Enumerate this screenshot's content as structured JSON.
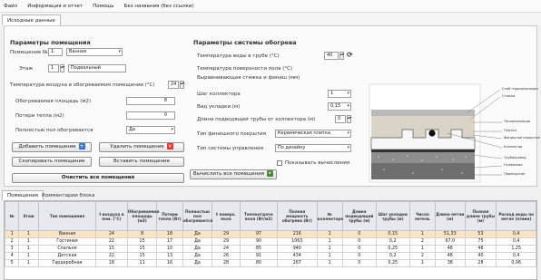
{
  "menu": [
    "Файл",
    "Информация и отчет",
    "Помощь",
    "Без названия (без ссылки)"
  ],
  "tabs": {
    "main": "Исходные данные"
  },
  "room_params": {
    "header": "Параметры помещения",
    "room_number_label": "Помещение №1",
    "room_number_value": "1",
    "room_name_value": "Ванная",
    "floor_label": "Этаж",
    "floor_value": "1",
    "floor_name_value": "Подвальный",
    "air_temp_label": "Температура воздуха в обогреваемом помещении (°C)",
    "air_temp_value": "24",
    "heated_area_label": "Обогреваемая площадь (м2)",
    "heated_area_value": "8",
    "heat_losses_label": "Потери тепла (м2)",
    "heat_losses_value": "0",
    "full_floor_label": "Полностью пол обогревается",
    "full_floor_value": "Да",
    "add_room_label": "Добавить помещение",
    "delete_room_label": "Удалить помещение",
    "copy_room_label": "Скопировать помещение",
    "paste_room_label": "Вставить помещение",
    "clear_rooms_label": "Очистить все помещения"
  },
  "heating_params": {
    "header": "Параметры системы обогрева",
    "water_temp_label": "Температура воды в трубе (°C)",
    "water_temp_value": "40",
    "return_temp_label": "Температура поверхности пола (°C)",
    "return_temp_value": "",
    "screed_label": "Выравнивающая стяжка и финиш (мм)",
    "screed_value": "",
    "pipe_step_label": "Шаг коллектора",
    "pipe_step_value": "1",
    "pipe_diam_label": "Вид укладки (м)",
    "pipe_diam_value": "0,15",
    "length_label": "Длина подводящей трубы от коллектора (м)",
    "length_value": "0",
    "coating_label": "Тип финишного покрытия",
    "coating_value": "Керамическая плитка",
    "regulation_label": "Тип системы управления",
    "regulation_value": "По дизайну",
    "auto_calc_label": "Показывать вычисления",
    "calc_all_label": "Вычислить все помещения"
  },
  "diagram": {
    "labels": [
      "Слой гидроизоляции",
      "Стяжка",
      "Теплоизоляция",
      "Плитка",
      "Финишное покрытие",
      "Коллектор",
      "Трубопровод",
      "Основание",
      "Перекрытие"
    ]
  },
  "section_tabs": [
    "Помещения",
    "Комментарии блока"
  ],
  "table": {
    "columns": [
      "№",
      "Этаж",
      "Тип помещения",
      "t воздуха в пом. (°C)",
      "Обогреваемая площадь (м2)",
      "Потери тепла (Вт)",
      "Полностью пол обогревается",
      "t поверх. пола",
      "Теплоотдача пола (Вт/м2)",
      "Полная мощность обогрева (Вт)",
      "№ коллектора",
      "Длина подводящей трубы (м)",
      "Шаг укладки трубы (м)",
      "Число петель",
      "Длина петли (м)",
      "Полная длина трубы (м)",
      "Расход воды по петле (л/мин)"
    ],
    "rows": [
      [
        "1",
        "1",
        "Ванная",
        "24",
        "8",
        "18",
        "Да",
        "29",
        "97",
        "216",
        "1",
        "0",
        "0,15",
        "1",
        "51,33",
        "53",
        "0,4"
      ],
      [
        "2",
        "1",
        "Гостиная",
        "22",
        "15",
        "17",
        "Да",
        "29",
        "90",
        "1063",
        "1",
        "0",
        "0,2",
        "2",
        "67,0",
        "75",
        "0,4"
      ],
      [
        "3",
        "1",
        "Спальня",
        "15",
        "15",
        "10",
        "Да",
        "24",
        "85",
        "940",
        "1",
        "0",
        "0,25",
        "1",
        "48",
        "48",
        "1,25"
      ],
      [
        "4",
        "1",
        "Детская",
        "22",
        "15",
        "13",
        "Да",
        "26",
        "91",
        "434",
        "1",
        "0",
        "0,2",
        "2",
        "48",
        "40",
        "0,4"
      ],
      [
        "5",
        "1",
        "Гардеробная",
        "18",
        "11",
        "16",
        "Да",
        "28",
        "80",
        "267",
        "1",
        "0",
        "0,25",
        "1",
        "38",
        "28",
        "0,06"
      ]
    ]
  }
}
